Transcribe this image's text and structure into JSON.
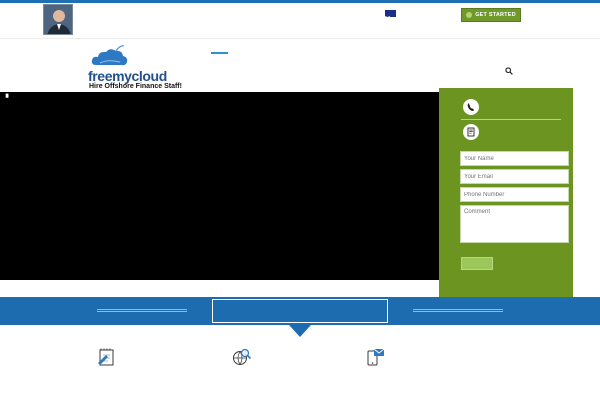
{
  "topbar": {
    "cta_label": "GET STARTED",
    "avatar_icon": "person-avatar",
    "flag_icon": "australia-flag-icon"
  },
  "header": {
    "logo_text": "freemycloud",
    "logo_tagline": "Hire Offshore Finance Staff!",
    "search_icon": "search-icon"
  },
  "contact_form": {
    "name_placeholder": "Your Name",
    "email_placeholder": "Your Email",
    "phone_placeholder": "Phone Number",
    "comment_placeholder": "Comment"
  },
  "colors": {
    "accent_blue": "#1d6cb0",
    "form_green": "#6b9421",
    "cta_green": "#6f9a2a"
  },
  "features": {
    "icons": [
      "notepad-pencil-icon",
      "globe-search-icon",
      "mobile-mail-icon"
    ]
  }
}
